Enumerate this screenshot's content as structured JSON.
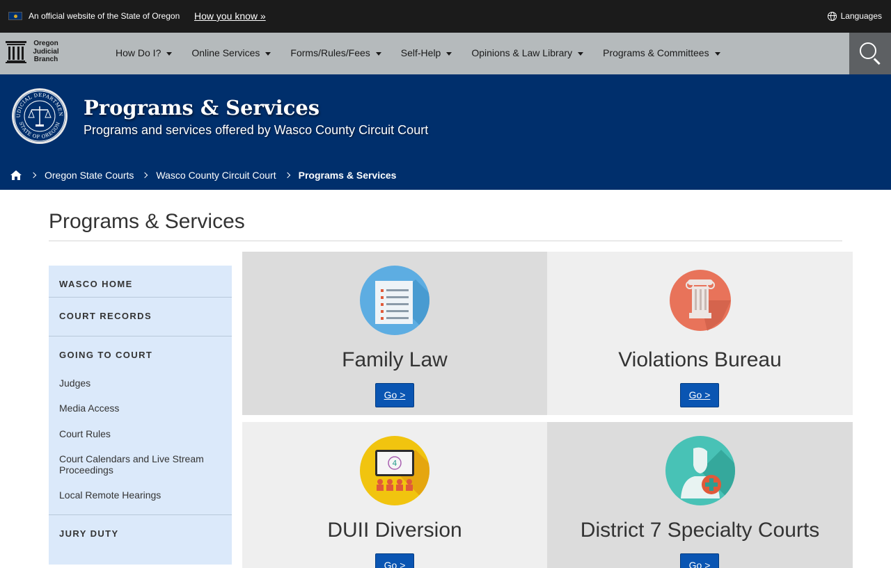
{
  "official_bar": {
    "text": "An official website of the State of Oregon",
    "how_link": "How you know »",
    "languages": "Languages"
  },
  "logo": {
    "line1": "Oregon",
    "line2": "Judicial",
    "line3": "Branch"
  },
  "nav": {
    "items": [
      {
        "label": "How Do I?"
      },
      {
        "label": "Online Services"
      },
      {
        "label": "Forms/Rules/Fees"
      },
      {
        "label": "Self-Help"
      },
      {
        "label": "Opinions & Law Library"
      },
      {
        "label": "Programs & Committees"
      }
    ]
  },
  "banner": {
    "title": "Programs & Services",
    "subtitle": "Programs and services offered by Wasco County Circuit Court",
    "seal_text_top": "JUDICIAL DEPARTMENT",
    "seal_text_bottom": "STATE OF OREGON"
  },
  "breadcrumb": {
    "items": [
      "Oregon State Courts",
      "Wasco County Circuit Court",
      "Programs & Services"
    ]
  },
  "page": {
    "title": "Programs & Services"
  },
  "sidebar": {
    "wasco_home": "WASCO HOME",
    "court_records": "COURT RECORDS",
    "going_to_court": "GOING TO COURT",
    "links": [
      "Judges",
      "Media Access",
      "Court Rules",
      "Court Calendars and Live Stream Proceedings",
      "Local Remote Hearings"
    ],
    "jury_duty": "JURY DUTY"
  },
  "cards": [
    {
      "title": "Family Law",
      "button": "Go >",
      "icon": "document-icon",
      "color": "#5dade2"
    },
    {
      "title": "Violations Bureau",
      "button": "Go >",
      "icon": "column-icon",
      "color": "#e8735a"
    },
    {
      "title": "DUII Diversion",
      "button": "Go >",
      "icon": "classroom-icon",
      "color": "#f1c40f"
    },
    {
      "title": "District 7 Specialty Courts",
      "button": "Go >",
      "icon": "person-medical-icon",
      "color": "#48c2b6"
    }
  ],
  "colors": {
    "top_bar": "#1b1b1b",
    "nav_bar": "#b5babc",
    "banner": "#002f6c",
    "sidebar": "#dbe9fa",
    "button": "#0a55b2"
  }
}
